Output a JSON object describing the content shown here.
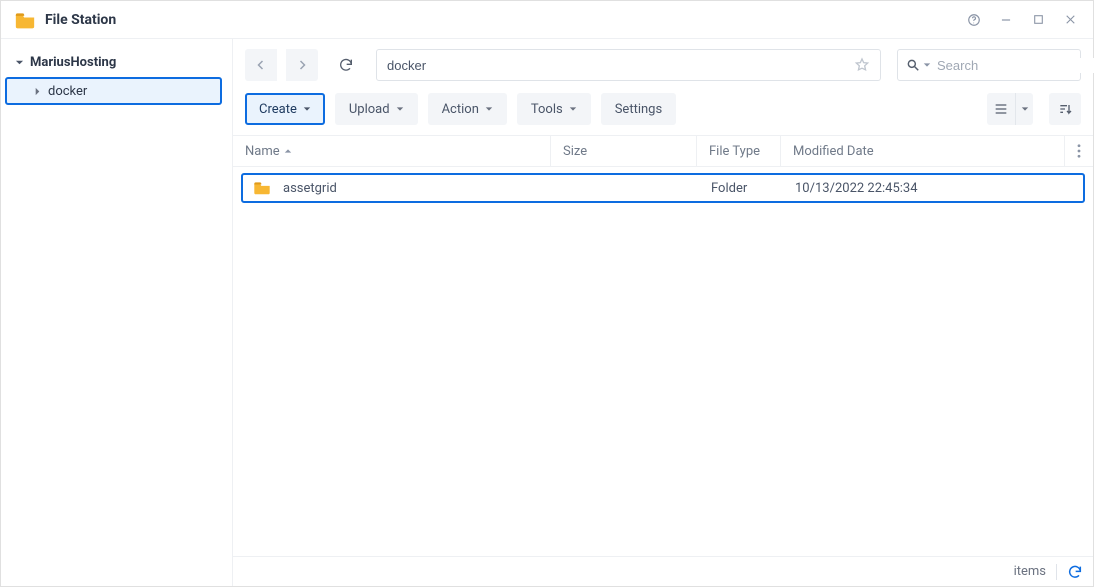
{
  "app": {
    "title": "File Station"
  },
  "sidebar": {
    "root_label": "MariusHosting",
    "items": [
      {
        "label": "docker"
      }
    ]
  },
  "nav": {
    "path": "docker"
  },
  "search": {
    "placeholder": "Search"
  },
  "toolbar": {
    "create_label": "Create",
    "upload_label": "Upload",
    "action_label": "Action",
    "tools_label": "Tools",
    "settings_label": "Settings"
  },
  "columns": {
    "name": "Name",
    "size": "Size",
    "type": "File Type",
    "modified": "Modified Date"
  },
  "rows": [
    {
      "name": "assetgrid",
      "size": "",
      "type": "Folder",
      "modified": "10/13/2022 22:45:34"
    }
  ],
  "status": {
    "items_label": "items"
  }
}
